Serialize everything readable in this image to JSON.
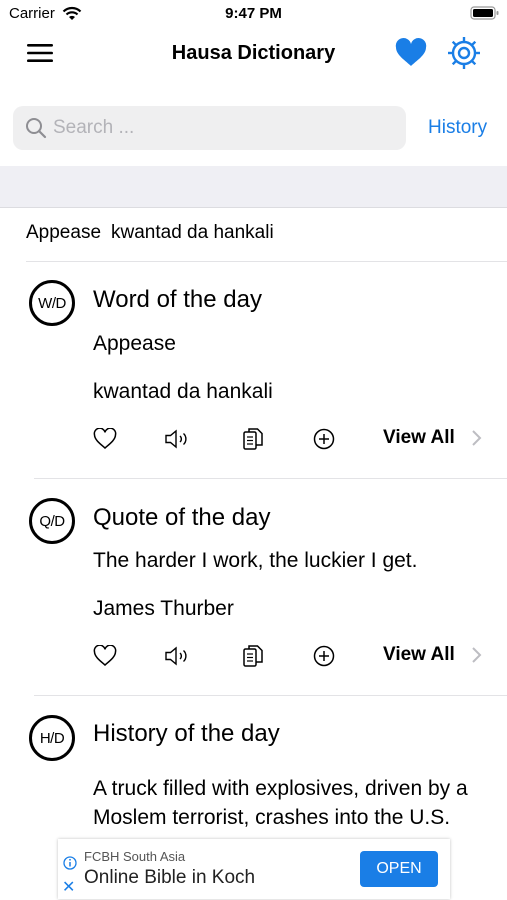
{
  "status_bar": {
    "carrier": "Carrier",
    "time": "9:47 PM"
  },
  "nav": {
    "title": "Hausa Dictionary"
  },
  "search": {
    "placeholder": "Search ...",
    "history_label": "History"
  },
  "recent": {
    "word": "Appease",
    "translation": "kwantad da hankali"
  },
  "cards": {
    "word": {
      "badge": "W/D",
      "title": "Word of the day",
      "line1": "Appease",
      "line2": "kwantad da hankali",
      "view_all": "View All"
    },
    "quote": {
      "badge": "Q/D",
      "title": "Quote of the day",
      "line1": "The harder I work, the luckier I get.",
      "line2": "James Thurber",
      "view_all": "View All"
    },
    "history": {
      "badge": "H/D",
      "title": "History of the day",
      "body": "A truck filled with explosives, driven by a Moslem terrorist, crashes into the U.S. Marine barracks in Beirut"
    }
  },
  "ad": {
    "source": "FCBH South Asia",
    "title": "Online Bible in Koch",
    "button": "OPEN",
    "close": "✕"
  },
  "colors": {
    "accent": "#1a7ee6",
    "band": "#efeff4"
  },
  "icons": [
    "wifi-icon",
    "battery-icon",
    "menu-icon",
    "heart-icon",
    "gear-icon",
    "search-icon",
    "speaker-icon",
    "copy-icon",
    "add-icon",
    "chevron-right-icon",
    "info-icon"
  ]
}
